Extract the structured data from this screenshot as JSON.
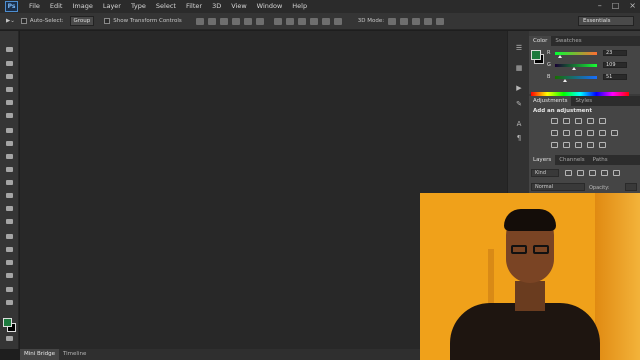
{
  "app": {
    "logo": "Ps"
  },
  "menu": [
    "File",
    "Edit",
    "Image",
    "Layer",
    "Type",
    "Select",
    "Filter",
    "3D",
    "View",
    "Window",
    "Help"
  ],
  "options_bar": {
    "auto_select_label": "Auto-Select:",
    "auto_select_value": "Group",
    "transform_label": "Show Transform Controls",
    "mode_3d": "3D Mode:",
    "workspace": "Essentials"
  },
  "color_panel": {
    "tabs": [
      "Color",
      "Swatches"
    ],
    "foreground_color": "#1d7a3e",
    "background_color": "#000000",
    "channels": [
      {
        "label": "R",
        "value": "23"
      },
      {
        "label": "G",
        "value": "109"
      },
      {
        "label": "B",
        "value": "51"
      }
    ]
  },
  "adjustments_panel": {
    "tabs": [
      "Adjustments",
      "Styles"
    ],
    "title": "Add an adjustment"
  },
  "layers_panel": {
    "tabs": [
      "Layers",
      "Channels",
      "Paths"
    ],
    "filter_kind": "Kind",
    "blend_mode": "Normal",
    "opacity_label": "Opacity:"
  },
  "bottom_tabs": [
    "Mini Bridge",
    "Timeline"
  ],
  "icons": {
    "tools": [
      "move-tool-icon",
      "marquee-tool-icon",
      "lasso-tool-icon",
      "quick-select-tool-icon",
      "crop-tool-icon",
      "eyedropper-tool-icon",
      "healing-brush-icon",
      "brush-tool-icon",
      "clone-stamp-icon",
      "history-brush-icon",
      "eraser-tool-icon",
      "gradient-tool-icon",
      "blur-tool-icon",
      "dodge-tool-icon",
      "pen-tool-icon",
      "type-tool-icon",
      "path-select-icon",
      "rectangle-tool-icon",
      "hand-tool-icon",
      "zoom-tool-icon"
    ]
  }
}
